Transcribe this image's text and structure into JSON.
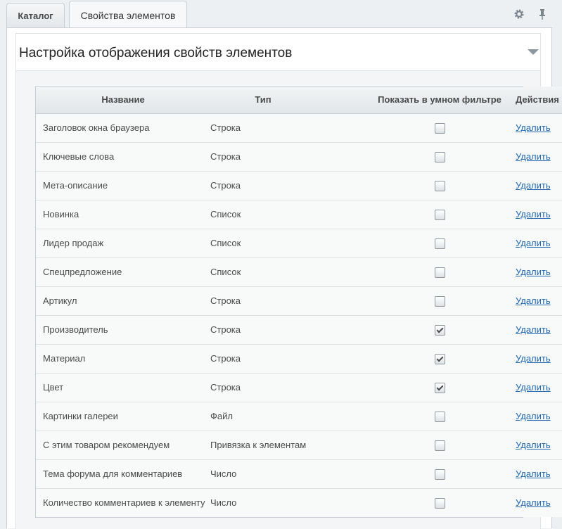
{
  "tabs": [
    {
      "label": "Каталог",
      "active": false
    },
    {
      "label": "Свойства элементов",
      "active": true
    }
  ],
  "toolbar": {
    "settings_icon": "gear-icon",
    "pin_icon": "pin-icon"
  },
  "section": {
    "title": "Настройка отображения свойств элементов",
    "collapse_icon": "chevron-down-icon"
  },
  "table": {
    "columns": [
      "Название",
      "Тип",
      "Показать в умном фильтре",
      "Действия"
    ],
    "rows": [
      {
        "name": "Заголовок окна браузера",
        "type": "Строка",
        "filter": false,
        "action": "Удалить"
      },
      {
        "name": "Ключевые слова",
        "type": "Строка",
        "filter": false,
        "action": "Удалить"
      },
      {
        "name": "Мета-описание",
        "type": "Строка",
        "filter": false,
        "action": "Удалить"
      },
      {
        "name": "Новинка",
        "type": "Список",
        "filter": false,
        "action": "Удалить"
      },
      {
        "name": "Лидер продаж",
        "type": "Список",
        "filter": false,
        "action": "Удалить"
      },
      {
        "name": "Спецпредложение",
        "type": "Список",
        "filter": false,
        "action": "Удалить"
      },
      {
        "name": "Артикул",
        "type": "Строка",
        "filter": false,
        "action": "Удалить"
      },
      {
        "name": "Производитель",
        "type": "Строка",
        "filter": true,
        "action": "Удалить"
      },
      {
        "name": "Материал",
        "type": "Строка",
        "filter": true,
        "action": "Удалить"
      },
      {
        "name": "Цвет",
        "type": "Строка",
        "filter": true,
        "action": "Удалить"
      },
      {
        "name": "Картинки галереи",
        "type": "Файл",
        "filter": false,
        "action": "Удалить"
      },
      {
        "name": "С этим товаром рекомендуем",
        "type": "Привязка к элементам",
        "filter": false,
        "action": "Удалить"
      },
      {
        "name": "Тема форума для комментариев",
        "type": "Число",
        "filter": false,
        "action": "Удалить"
      },
      {
        "name": "Количество комментариев к элементу",
        "type": "Число",
        "filter": false,
        "action": "Удалить"
      }
    ]
  },
  "colors": {
    "link": "#2067b0",
    "border": "#c8ced3",
    "background": "#edf0f2"
  }
}
